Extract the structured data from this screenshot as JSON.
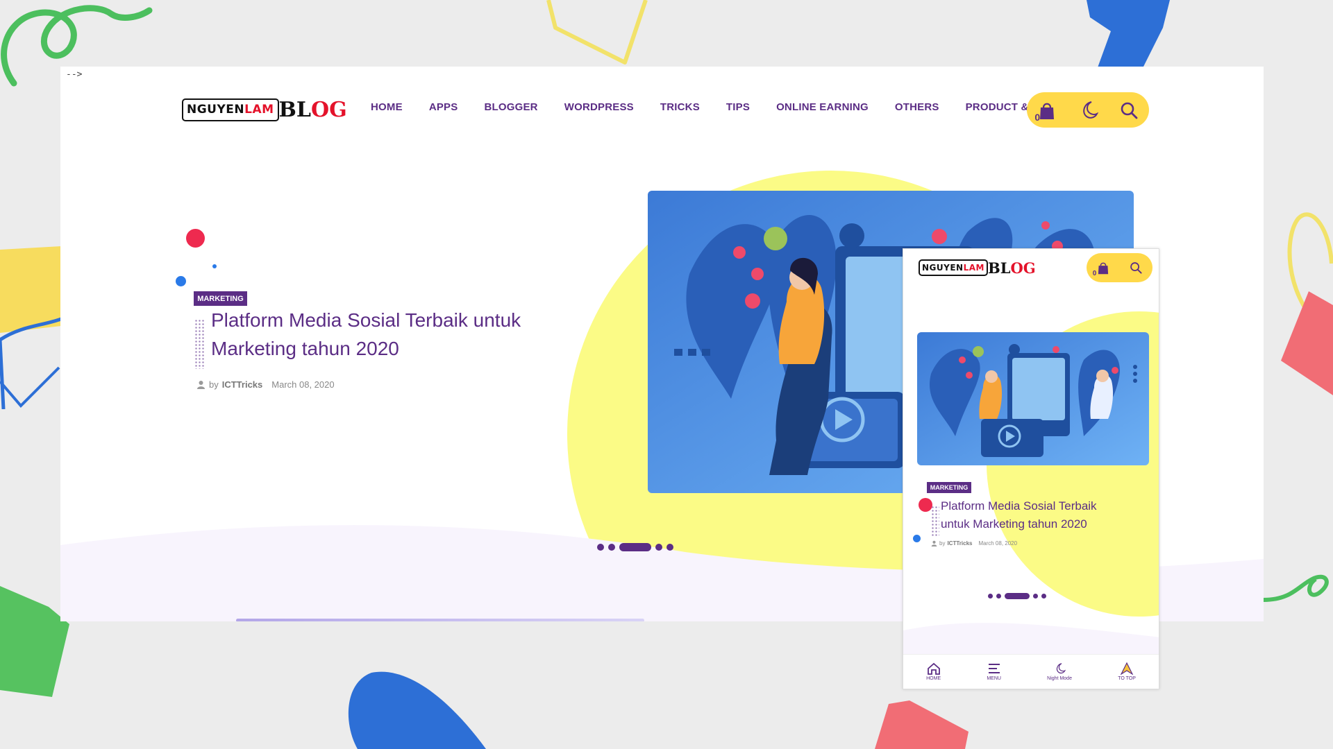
{
  "page": {
    "html_comment_artifact": "-->"
  },
  "brand": {
    "logo_part1": "NGUYEN",
    "logo_part2": "LAM",
    "logo_blog_part1": "BL",
    "logo_blog_part2": "OG"
  },
  "nav": {
    "items": [
      {
        "label": "HOME"
      },
      {
        "label": "APPS"
      },
      {
        "label": "BLOGGER"
      },
      {
        "label": "WORDPRESS"
      },
      {
        "label": "TRICKS"
      },
      {
        "label": "TIPS"
      },
      {
        "label": "ONLINE EARNING"
      },
      {
        "label": "OTHERS"
      },
      {
        "label": "PRODUCT & SERVICES"
      }
    ]
  },
  "toolbar": {
    "cart_count": "0",
    "cart_icon": "shopping-bag-icon",
    "night_icon": "moon-icon",
    "search_icon": "search-icon"
  },
  "hero": {
    "category": "MARKETING",
    "title_line1": "Platform Media Sosial Terbaik untuk",
    "title_line2": "Marketing tahun 2020",
    "by_label": "by",
    "author": "ICTTricks",
    "date": "March 08, 2020",
    "slides_total": 5,
    "slide_active": 3
  },
  "mobile": {
    "category": "MARKETING",
    "title_line1": "Platform Media Sosial Terbaik",
    "title_line2": "untuk Marketing tahun 2020",
    "by_label": "by",
    "author": "ICTTricks",
    "date": "March 08, 2020",
    "bottom_nav": [
      {
        "label": "HOME",
        "icon": "home-icon"
      },
      {
        "label": "MENU",
        "icon": "menu-icon"
      },
      {
        "label": "Night Mode",
        "icon": "moon-icon"
      },
      {
        "label": "TO TOP",
        "icon": "arrow-up-icon"
      }
    ]
  },
  "colors": {
    "brand_purple": "#5b2d85",
    "accent_yellow": "#ffd94a",
    "blob_yellow": "#fbfb86",
    "logo_red": "#e4122a",
    "dot_red": "#ee2a4f",
    "dot_blue": "#2a7ae8",
    "illustration_blue": "#3f7fd6"
  }
}
